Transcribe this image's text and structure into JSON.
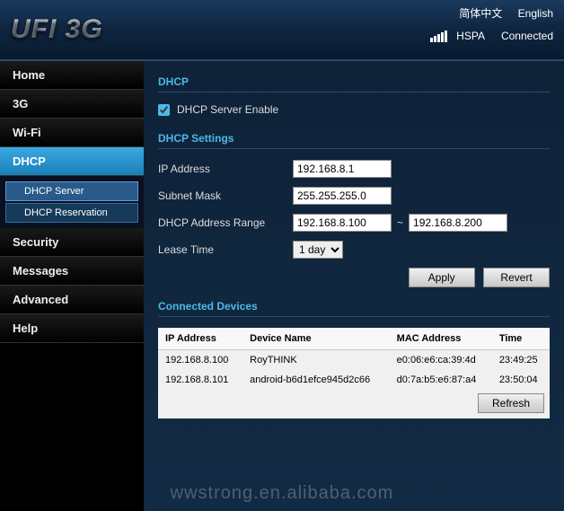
{
  "header": {
    "logo": "UFI 3G",
    "lang_cn": "简体中文",
    "lang_en": "English",
    "network": "HSPA",
    "status": "Connected"
  },
  "nav": {
    "home": "Home",
    "threeg": "3G",
    "wifi": "Wi-Fi",
    "dhcp": "DHCP",
    "dhcp_server": "DHCP Server",
    "dhcp_reservation": "DHCP Reservation",
    "security": "Security",
    "messages": "Messages",
    "advanced": "Advanced",
    "help": "Help"
  },
  "dhcp": {
    "title": "DHCP",
    "enable_label": "DHCP Server Enable",
    "enable_checked": true,
    "settings_title": "DHCP Settings",
    "ip_label": "IP Address",
    "ip_value": "192.168.8.1",
    "mask_label": "Subnet Mask",
    "mask_value": "255.255.255.0",
    "range_label": "DHCP Address Range",
    "range_start": "192.168.8.100",
    "range_end": "192.168.8.200",
    "lease_label": "Lease Time",
    "lease_value": "1 day",
    "apply": "Apply",
    "revert": "Revert",
    "devices_title": "Connected Devices",
    "col_ip": "IP Address",
    "col_name": "Device Name",
    "col_mac": "MAC Address",
    "col_time": "Time",
    "rows": [
      {
        "ip": "192.168.8.100",
        "name": "RoyTHINK",
        "mac": "e0:06:e6:ca:39:4d",
        "time": "23:49:25"
      },
      {
        "ip": "192.168.8.101",
        "name": "android-b6d1efce945d2c66",
        "mac": "d0:7a:b5:e6:87:a4",
        "time": "23:50:04"
      }
    ],
    "refresh": "Refresh"
  },
  "watermark": "wwstrong.en.alibaba.com"
}
